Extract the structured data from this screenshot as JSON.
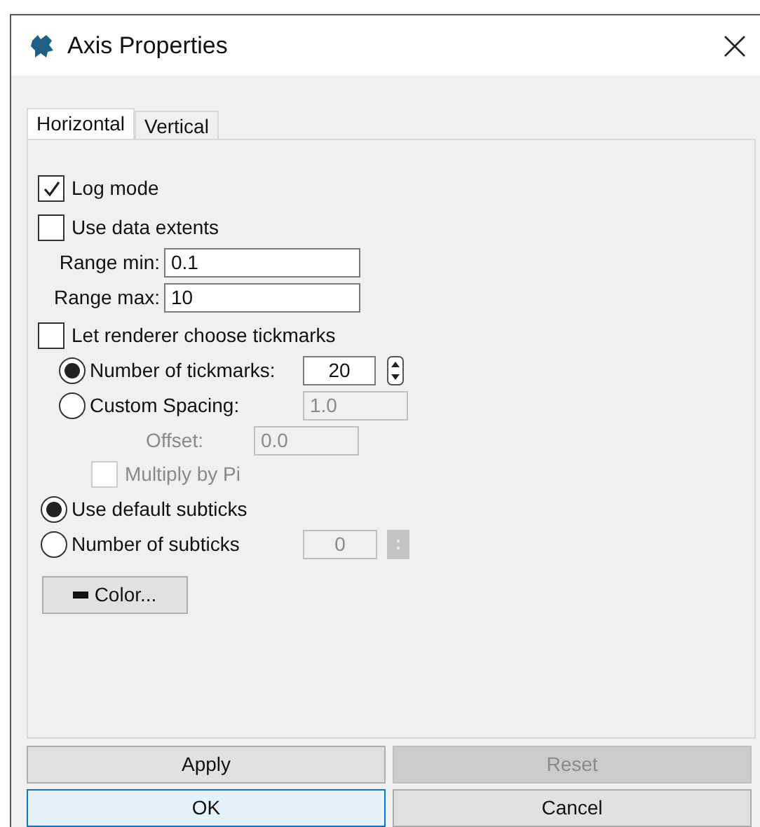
{
  "window": {
    "title": "Axis Properties"
  },
  "tabs": [
    {
      "label": "Horizontal",
      "selected": true
    },
    {
      "label": "Vertical",
      "selected": false
    }
  ],
  "log_mode": {
    "label": "Log mode",
    "checked": true
  },
  "use_data_extents": {
    "label": "Use data extents",
    "checked": false
  },
  "range_min": {
    "label": "Range min:",
    "value": "0.1"
  },
  "range_max": {
    "label": "Range max:",
    "value": "10"
  },
  "let_renderer_choose": {
    "label": "Let renderer choose tickmarks",
    "checked": false
  },
  "tickmark_modes": [
    {
      "label": "Number of tickmarks:",
      "selected": true,
      "value": "20",
      "disabled": false,
      "spinner": true
    },
    {
      "label": "Custom Spacing:",
      "selected": false,
      "value": "1.0",
      "disabled": true,
      "spinner": false
    }
  ],
  "offset": {
    "label": "Offset:",
    "value": "0.0",
    "disabled": true
  },
  "multiply_by_pi": {
    "label": "Multiply by Pi",
    "checked": false,
    "disabled": true
  },
  "subtick_modes": [
    {
      "label": "Use default subticks",
      "selected": true
    },
    {
      "label": "Number of subticks",
      "selected": false,
      "value": "0",
      "disabled": true
    }
  ],
  "color_button": {
    "label": "Color..."
  },
  "buttons": [
    {
      "label": "Apply",
      "disabled": false,
      "focused": false
    },
    {
      "label": "Reset",
      "disabled": true,
      "focused": false
    },
    {
      "label": "OK",
      "disabled": false,
      "focused": true
    },
    {
      "label": "Cancel",
      "disabled": false,
      "focused": false
    }
  ]
}
